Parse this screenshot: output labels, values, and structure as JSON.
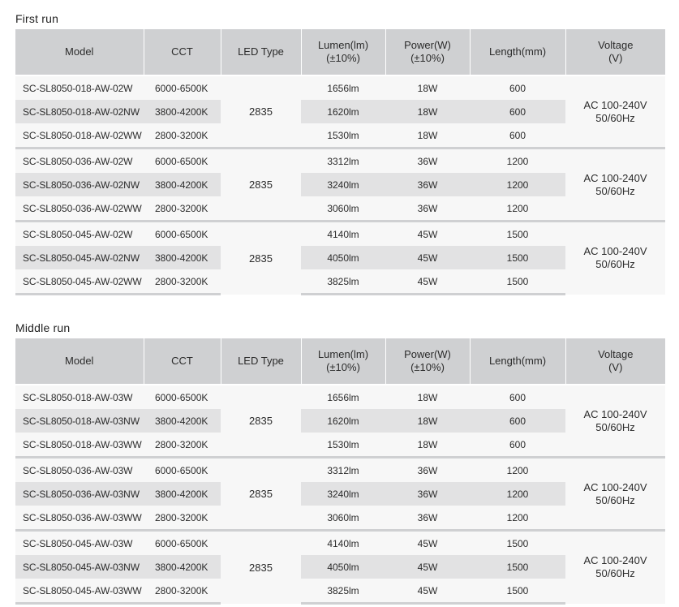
{
  "sections": [
    {
      "title": "First run",
      "headers": {
        "model": "Model",
        "cct": "CCT",
        "led_type": "LED Type",
        "lumen_l1": "Lumen(lm)",
        "lumen_l2": "(±10%)",
        "power_l1": "Power(W)",
        "power_l2": "(±10%)",
        "length": "Length(mm)",
        "voltage_l1": "Voltage",
        "voltage_l2": "(V)"
      },
      "groups": [
        {
          "led_type": "2835",
          "voltage_l1": "AC 100-240V",
          "voltage_l2": "50/60Hz",
          "rows": [
            {
              "model": "SC-SL8050-018-AW-02W",
              "cct": "6000-6500K",
              "lumen": "1656lm",
              "power": "18W",
              "length": "600"
            },
            {
              "model": "SC-SL8050-018-AW-02NW",
              "cct": "3800-4200K",
              "lumen": "1620lm",
              "power": "18W",
              "length": "600"
            },
            {
              "model": "SC-SL8050-018-AW-02WW",
              "cct": "2800-3200K",
              "lumen": "1530lm",
              "power": "18W",
              "length": "600"
            }
          ]
        },
        {
          "led_type": "2835",
          "voltage_l1": "AC 100-240V",
          "voltage_l2": "50/60Hz",
          "rows": [
            {
              "model": "SC-SL8050-036-AW-02W",
              "cct": "6000-6500K",
              "lumen": "3312lm",
              "power": "36W",
              "length": "1200"
            },
            {
              "model": "SC-SL8050-036-AW-02NW",
              "cct": "3800-4200K",
              "lumen": "3240lm",
              "power": "36W",
              "length": "1200"
            },
            {
              "model": "SC-SL8050-036-AW-02WW",
              "cct": "2800-3200K",
              "lumen": "3060lm",
              "power": "36W",
              "length": "1200"
            }
          ]
        },
        {
          "led_type": "2835",
          "voltage_l1": "AC 100-240V",
          "voltage_l2": "50/60Hz",
          "rows": [
            {
              "model": "SC-SL8050-045-AW-02W",
              "cct": "6000-6500K",
              "lumen": "4140lm",
              "power": "45W",
              "length": "1500"
            },
            {
              "model": "SC-SL8050-045-AW-02NW",
              "cct": "3800-4200K",
              "lumen": "4050lm",
              "power": "45W",
              "length": "1500"
            },
            {
              "model": "SC-SL8050-045-AW-02WW",
              "cct": "2800-3200K",
              "lumen": "3825lm",
              "power": "45W",
              "length": "1500"
            }
          ]
        }
      ]
    },
    {
      "title": "Middle run",
      "headers": {
        "model": "Model",
        "cct": "CCT",
        "led_type": "LED Type",
        "lumen_l1": "Lumen(lm)",
        "lumen_l2": "(±10%)",
        "power_l1": "Power(W)",
        "power_l2": "(±10%)",
        "length": "Length(mm)",
        "voltage_l1": "Voltage",
        "voltage_l2": "(V)"
      },
      "groups": [
        {
          "led_type": "2835",
          "voltage_l1": "AC 100-240V",
          "voltage_l2": "50/60Hz",
          "rows": [
            {
              "model": "SC-SL8050-018-AW-03W",
              "cct": "6000-6500K",
              "lumen": "1656lm",
              "power": "18W",
              "length": "600"
            },
            {
              "model": "SC-SL8050-018-AW-03NW",
              "cct": "3800-4200K",
              "lumen": "1620lm",
              "power": "18W",
              "length": "600"
            },
            {
              "model": "SC-SL8050-018-AW-03WW",
              "cct": "2800-3200K",
              "lumen": "1530lm",
              "power": "18W",
              "length": "600"
            }
          ]
        },
        {
          "led_type": "2835",
          "voltage_l1": "AC 100-240V",
          "voltage_l2": "50/60Hz",
          "rows": [
            {
              "model": "SC-SL8050-036-AW-03W",
              "cct": "6000-6500K",
              "lumen": "3312lm",
              "power": "36W",
              "length": "1200"
            },
            {
              "model": "SC-SL8050-036-AW-03NW",
              "cct": "3800-4200K",
              "lumen": "3240lm",
              "power": "36W",
              "length": "1200"
            },
            {
              "model": "SC-SL8050-036-AW-03WW",
              "cct": "2800-3200K",
              "lumen": "3060lm",
              "power": "36W",
              "length": "1200"
            }
          ]
        },
        {
          "led_type": "2835",
          "voltage_l1": "AC 100-240V",
          "voltage_l2": "50/60Hz",
          "rows": [
            {
              "model": "SC-SL8050-045-AW-03W",
              "cct": "6000-6500K",
              "lumen": "4140lm",
              "power": "45W",
              "length": "1500"
            },
            {
              "model": "SC-SL8050-045-AW-03NW",
              "cct": "3800-4200K",
              "lumen": "4050lm",
              "power": "45W",
              "length": "1500"
            },
            {
              "model": "SC-SL8050-045-AW-03WW",
              "cct": "2800-3200K",
              "lumen": "3825lm",
              "power": "45W",
              "length": "1500"
            }
          ]
        }
      ]
    }
  ]
}
